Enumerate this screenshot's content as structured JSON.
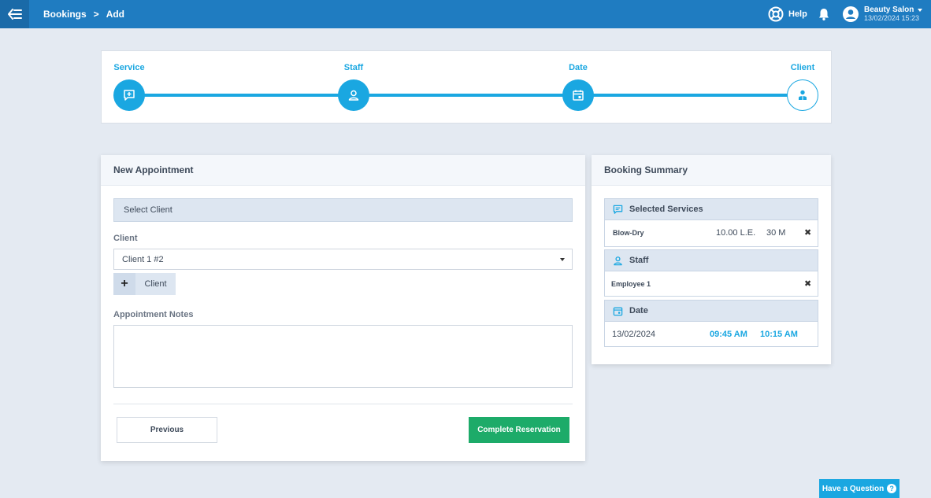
{
  "breadcrumb": {
    "section": "Bookings",
    "separator": ">",
    "page": "Add"
  },
  "header": {
    "help_label": "Help",
    "user_name": "Beauty Salon",
    "user_datetime": "13/02/2024 15:23"
  },
  "steps": [
    {
      "label": "Service",
      "icon": "chat-plus-icon",
      "state": "complete"
    },
    {
      "label": "Staff",
      "icon": "user-icon",
      "state": "complete"
    },
    {
      "label": "Date",
      "icon": "calendar-icon",
      "state": "complete"
    },
    {
      "label": "Client",
      "icon": "client-icon",
      "state": "current"
    }
  ],
  "appointment": {
    "title": "New Appointment",
    "section_label": "Select Client",
    "client_label": "Client",
    "client_value": "Client 1 #2",
    "add_client_plus": "+",
    "add_client_label": "Client",
    "notes_label": "Appointment Notes",
    "notes_value": "",
    "previous_label": "Previous",
    "complete_label": "Complete Reservation"
  },
  "summary": {
    "title": "Booking Summary",
    "services_title": "Selected Services",
    "service_name": "Blow-Dry",
    "service_price": "10.00 L.E.",
    "service_duration": "30 M",
    "staff_title": "Staff",
    "staff_name": "Employee 1",
    "date_title": "Date",
    "date_value": "13/02/2024",
    "start_time": "09:45 AM",
    "end_time": "10:15 AM"
  },
  "help_button": {
    "label": "Have a Question",
    "icon": "?"
  },
  "colors": {
    "topbar": "#1f7cc1",
    "accent": "#1aa7e1",
    "success": "#1dab69",
    "background": "#e4eaf2"
  }
}
